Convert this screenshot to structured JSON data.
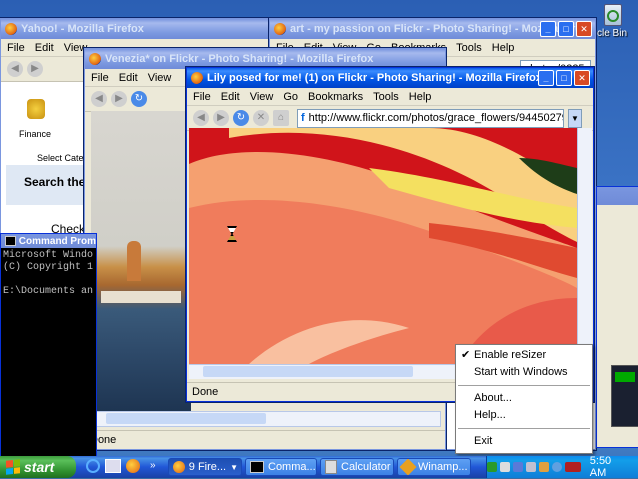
{
  "desktop": {
    "recycle_bin_label": "ycle Bin"
  },
  "win_yahoo": {
    "title": "Yahoo! - Mozilla Firefox",
    "menu": [
      "File",
      "Edit",
      "View"
    ],
    "finance_label": "Finance",
    "select_cat": "Select Categ",
    "search_text": "Search the W",
    "check_text": "Check"
  },
  "win_art": {
    "title": "art - my passion on Flickr - Photo Sharing! - Mozilla Fire",
    "menu": [
      "File",
      "Edit",
      "View",
      "Go",
      "Bookmarks",
      "Tools",
      "Help"
    ],
    "url": "photos/0335"
  },
  "win_venezia": {
    "title": "Venezia* on Flickr - Photo Sharing! - Mozilla Firefox",
    "menu": [
      "File",
      "Edit",
      "View"
    ],
    "status": "Done"
  },
  "win_lily": {
    "title": "Lily posed for me! (1) on Flickr - Photo Sharing! - Mozilla Firefox",
    "menu": [
      "File",
      "Edit",
      "View",
      "Go",
      "Bookmarks",
      "Tools",
      "Help"
    ],
    "url": "http://www.flickr.com/photos/grace_flowers/94450279",
    "status": "Done"
  },
  "cmd": {
    "title": "Command Prom",
    "lines": [
      "Microsoft Windo",
      "(C) Copyright 1",
      "",
      "E:\\Documents an"
    ]
  },
  "context_menu": {
    "items": [
      "Enable reSizer",
      "Start with Windows",
      "About...",
      "Help...",
      "Exit"
    ],
    "checked": "Enable reSizer"
  },
  "taskbar": {
    "start_label": "start",
    "buttons": [
      "9 Fire...",
      "Comma...",
      "Calculator",
      "Winamp..."
    ],
    "clock": "5:50 AM"
  },
  "colors": {
    "titlebar_active": "#0054e3",
    "taskbar": "#245edb",
    "start_green": "#3c9a3c"
  }
}
